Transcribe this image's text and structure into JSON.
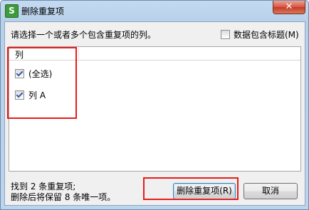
{
  "window": {
    "title": "删除重复项",
    "app_icon_glyph": "S",
    "close_glyph": "✕"
  },
  "dialog": {
    "instruction": "请选择一个或者多个包含重复项的列。",
    "header_checkbox": {
      "label": "数据包含标题(M)",
      "checked": false
    },
    "list": {
      "column_header": "列",
      "items": [
        {
          "label": "(全选)",
          "checked": true
        },
        {
          "label": "列 A",
          "checked": true
        }
      ]
    },
    "status_line1": "找到 2 条重复项;",
    "status_line2": "删除后将保留 8 条唯一项。",
    "buttons": {
      "delete_label": "删除重复项(R)",
      "cancel_label": "取消"
    }
  },
  "colors": {
    "highlight": "#e81b1b",
    "check_mark": "#3a5aa8"
  }
}
